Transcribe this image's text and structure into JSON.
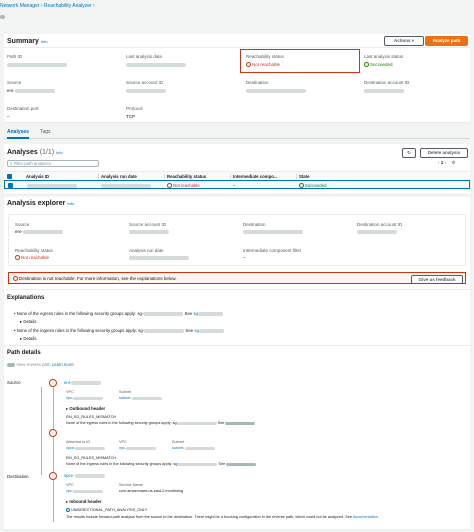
{
  "breadcrumb": {
    "parent": "Network Manager",
    "current": "Reachability Analyzer"
  },
  "summary": {
    "title": "Summary",
    "info": "Info",
    "actions_label": "Actions",
    "analyze_label": "Analyze path",
    "fields": {
      "path_id": "Path ID",
      "last_analysis_date": "Last analysis date",
      "reachability_status": "Reachability status",
      "reachability_value": "Not reachable",
      "last_analysis_status": "Last analysis status",
      "last_analysis_value": "Succeeded",
      "source": "Source",
      "source_value": "eni-",
      "source_account_id": "Source account ID",
      "destination": "Destination",
      "destination_account_id": "Destination account ID",
      "destination_port": "Destination port",
      "destination_port_value": "–",
      "protocol": "Protocol",
      "protocol_value": "TCP"
    }
  },
  "tabs": [
    {
      "label": "Analyses"
    },
    {
      "label": "Tags"
    }
  ],
  "analyses": {
    "title": "Analyses",
    "count": "(1/1)",
    "info": "Info",
    "delete_label": "Delete analysis",
    "filter_placeholder": "Filter path analyses",
    "pager": {
      "page": "1"
    },
    "columns": [
      "Analysis ID",
      "Analysis run date",
      "Reachability status",
      "Intermediate compo...",
      "State"
    ],
    "row": {
      "reachability": "Not reachable",
      "intermediate": "–",
      "state": "Succeeded"
    }
  },
  "explorer": {
    "title": "Analysis explorer",
    "info": "Info",
    "source": "Source",
    "source_value": "eni-",
    "source_account_id": "Source account ID",
    "destination": "Destination",
    "destination_account_id": "Destination account ID",
    "reachability_status": "Reachability status",
    "reachability_value": "Not reachable",
    "analysis_run_date": "Analysis run date",
    "intermediate": "Intermediate component filter",
    "intermediate_value": "–",
    "alert": "Destination is not reachable. For more information, see the explanations below.",
    "feedback_label": "Give us feedback"
  },
  "explanations": {
    "title": "Explanations",
    "items": [
      {
        "text": "None of the egress rules in the following security groups apply: sg-",
        "see": "See",
        "link": "sg",
        "details": "Details"
      },
      {
        "text": "None of the ingress rules in the following security groups apply: sg-",
        "see": "See",
        "link": "sg",
        "details": "Details"
      }
    ]
  },
  "path_details": {
    "title": "Path details",
    "reverse_label": "View reverse path",
    "learn_more": "Learn more",
    "source_label": "Source",
    "destination_label": "Destination",
    "source_node": "eni-",
    "vpc_label": "VPC",
    "subnet_label": "Subnet",
    "vpc_value": "vpc-",
    "subnet_value": "subnet-",
    "outbound_header": "Outbound header",
    "mismatch_code": "EM_SG_RULES_MISMATCH",
    "egress_text": "None of the egress rules in the following security groups apply: sg",
    "see": "See",
    "attached_label": "Attached to ID",
    "attached_value": "vpce-",
    "mismatch_code_2": "EM_SG_RULES_MISMATCH",
    "ingress_text": "None of the ingress rules in the following security groups apply: sg",
    "dest_node": "vpce-",
    "service_label": "Service Name",
    "service_value": "com.amazonaws.us-east-2.monitoring",
    "inbound_header": "Inbound header",
    "unidirectional": "UNIDIRECTIONAL_PATH_ANALYSIS_ONLY",
    "footer_text": "The results include forward path analysis from the source to the destination. There might be a blocking configuration in the reverse path, which could not be analyzed.",
    "footer_see": "See",
    "footer_link": "documentation."
  }
}
